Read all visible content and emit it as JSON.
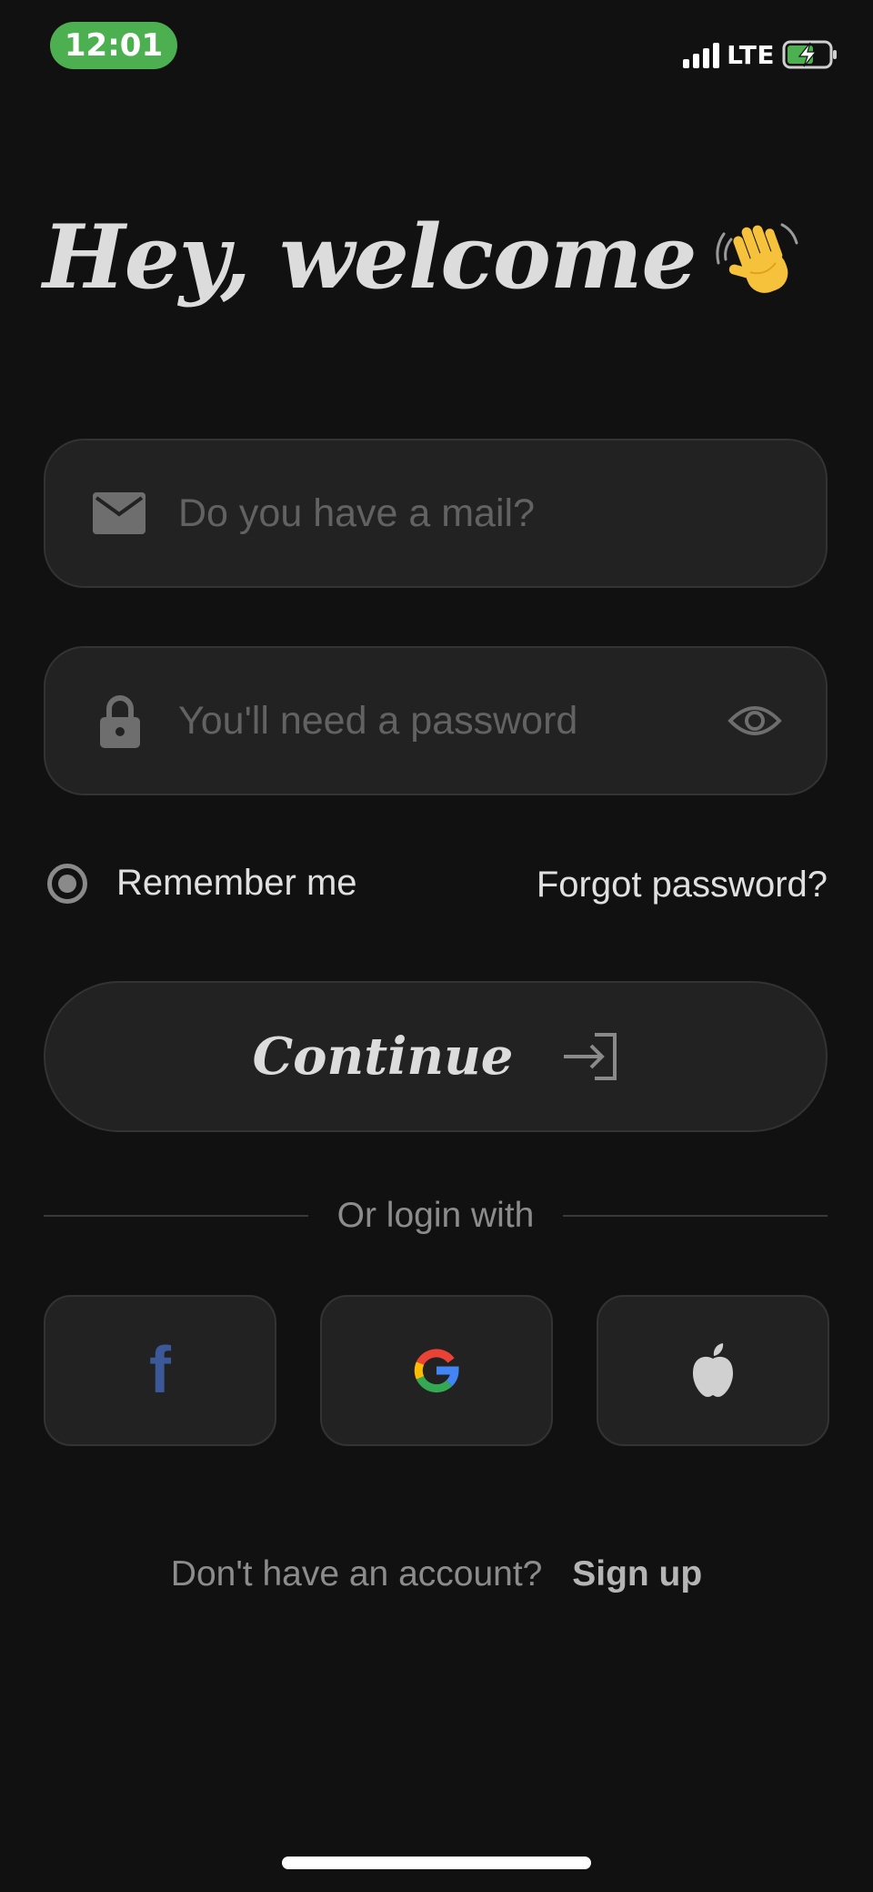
{
  "status_bar": {
    "time": "12:01",
    "network": "LTE",
    "battery_charging": true,
    "accent_color": "#4caf50"
  },
  "header": {
    "title": "Hey, welcome",
    "emoji_icon": "waving-hand-icon"
  },
  "form": {
    "email": {
      "placeholder": "Do you have a mail?",
      "value": "",
      "icon": "mail-icon"
    },
    "password": {
      "placeholder": "You'll need a password",
      "value": "",
      "icon": "lock-icon",
      "toggle_icon": "eye-icon"
    },
    "remember_label": "Remember me",
    "remember_checked": true,
    "forgot_label": "Forgot password?",
    "continue_label": "Continue",
    "continue_icon": "login-arrow-icon"
  },
  "social": {
    "divider_text": "Or login with",
    "providers": [
      "facebook",
      "google",
      "apple"
    ]
  },
  "footer": {
    "signup_question": "Don't have an account?",
    "signup_link": "Sign up"
  }
}
